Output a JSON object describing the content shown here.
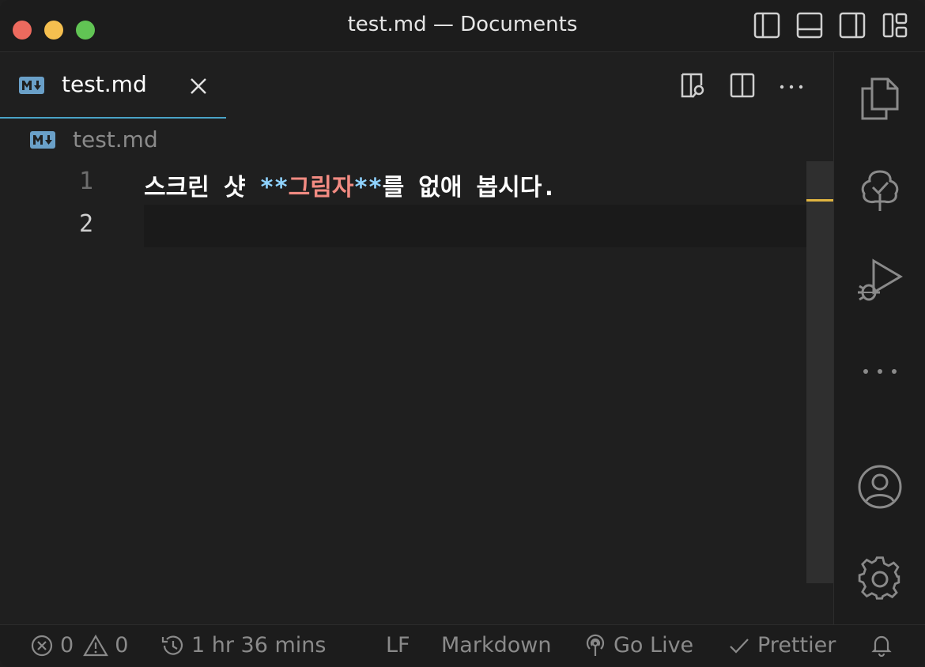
{
  "window": {
    "title": "test.md — Documents"
  },
  "tab": {
    "label": "test.md",
    "icon": "markdown-icon"
  },
  "breadcrumb": {
    "label": "test.md"
  },
  "editor": {
    "lines": [
      {
        "number": "1",
        "prefix": "스크린 샷 ",
        "star_open": "**",
        "bold": "그림자",
        "star_close": "**",
        "suffix": "를 없애 봅시다."
      },
      {
        "number": "2",
        "text": ""
      }
    ]
  },
  "status": {
    "errors": "0",
    "warnings": "0",
    "time": "1 hr 36 mins",
    "eol": "LF",
    "language": "Markdown",
    "go_live": "Go Live",
    "prettier": "Prettier"
  },
  "colors": {
    "accent_tab": "#4aa3c7",
    "star": "#8fd3ff",
    "bold": "#f28b82",
    "scroll_marker": "#e0b541"
  }
}
